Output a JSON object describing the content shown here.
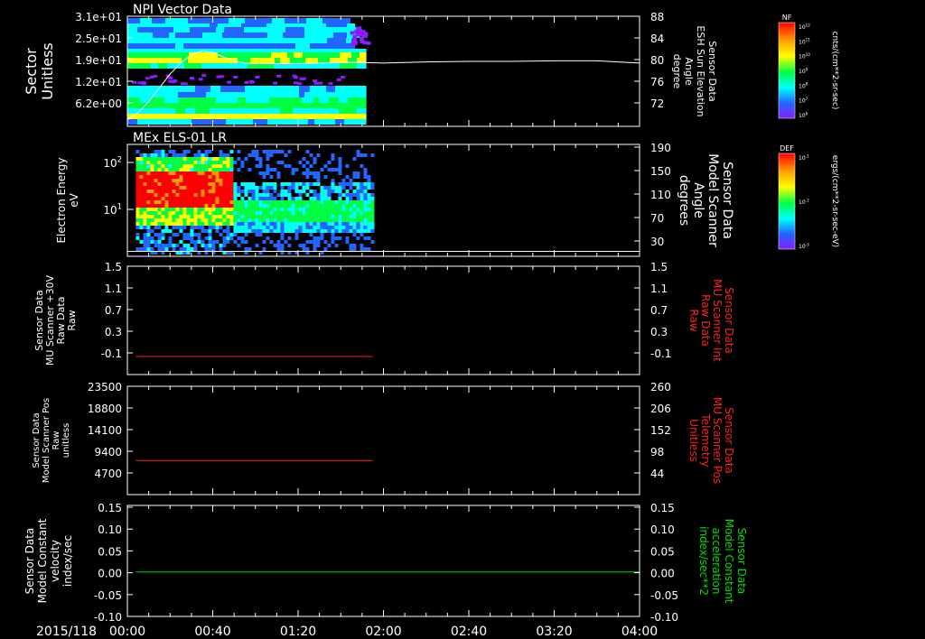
{
  "date_label": "2015/118",
  "time_axis": {
    "range_minutes": [
      0,
      240
    ],
    "tick_labels": [
      "00:00",
      "00:40",
      "01:20",
      "02:00",
      "02:40",
      "03:20",
      "04:00"
    ]
  },
  "colors": {
    "axis": "#ffffff",
    "red_series": "#ff2020",
    "green_series": "#00e000",
    "right_label_red": "#ff2020",
    "right_label_green": "#00e000"
  },
  "chart_data": [
    {
      "id": "panel1",
      "type": "heatmap",
      "title": "NPI Vector Data",
      "ylabel": [
        "Sector",
        "Unitless"
      ],
      "y_ticks": [
        "3.1e+01",
        "2.5e+01",
        "1.9e+01",
        "1.2e+01",
        "6.2e+00"
      ],
      "y2_ticks": [
        "88",
        "84",
        "80",
        "76",
        "72"
      ],
      "y2_range": [
        68,
        88
      ],
      "y2label": [
        "Sensor Data",
        "ESH Sun Elevation",
        "Angle",
        "degree"
      ],
      "colorbar": {
        "name": "NF",
        "units": "cnts/(cm**2-sr-sec)",
        "ticks": [
          "10^12",
          "10^11",
          "10^10",
          "10^9",
          "10^8",
          "10^7",
          "10^6"
        ]
      },
      "data_extent_minutes": [
        0,
        112
      ],
      "line_series": {
        "name": "ESH Sun Elevation Angle",
        "x": [
          0,
          5,
          10,
          15,
          20,
          25,
          30,
          35,
          40,
          45,
          50,
          55,
          60,
          70,
          80,
          90,
          100,
          110,
          120,
          140,
          160,
          180,
          200,
          220,
          235,
          240
        ],
        "y": [
          69.2,
          70.5,
          72.5,
          75.0,
          77.5,
          79.5,
          81.0,
          81.7,
          81.4,
          80.6,
          79.9,
          79.5,
          79.4,
          79.4,
          79.4,
          79.5,
          79.6,
          79.6,
          79.5,
          79.7,
          79.8,
          79.8,
          79.9,
          79.9,
          79.6,
          79.5
        ]
      }
    },
    {
      "id": "panel2",
      "type": "heatmap",
      "title": "MEx ELS-01 LR",
      "ylabel": [
        "Electron Energy",
        "eV"
      ],
      "y_ticks": [
        "10^2",
        "10^1"
      ],
      "y2_ticks": [
        "190",
        "150",
        "110",
        "70",
        "30"
      ],
      "y2_range": [
        10,
        190
      ],
      "y2label": [
        "Sensor Data",
        "Model Scanner",
        "Angle",
        "degrees"
      ],
      "colorbar": {
        "name": "DEF",
        "units": "ergs/(cm**2-sr-sec-eV)",
        "ticks": [
          "10^-1",
          "10^-2",
          "10^-3"
        ]
      },
      "data_extent_minutes": [
        4,
        115
      ],
      "line_series": {
        "name": "Model Scanner Angle",
        "x": [
          0,
          240
        ],
        "y": [
          18,
          18
        ]
      }
    },
    {
      "id": "panel3",
      "type": "line",
      "ylabel": [
        "Sensor Data",
        "MU Scanner +30V",
        "Raw Data",
        "Raw"
      ],
      "y_ticks": [
        "1.5",
        "1.1",
        "0.7",
        "0.3",
        "-0.1"
      ],
      "y_range": [
        -0.3,
        1.5
      ],
      "y2_ticks": [
        "1.5",
        "1.1",
        "0.7",
        "0.3",
        "-0.1"
      ],
      "y2label": [
        "Sensor Data",
        "MU Scanner Int",
        "Raw Data",
        "Raw"
      ],
      "series": [
        {
          "name": "MU Scanner Int Raw Data",
          "color": "red",
          "x": [
            4,
            115
          ],
          "y": [
            0.0,
            0.0
          ]
        }
      ]
    },
    {
      "id": "panel4",
      "type": "line",
      "ylabel": [
        "Sensor Data",
        "Model Scanner Pos",
        "Raw",
        "unitless"
      ],
      "y_ticks": [
        "23500",
        "18800",
        "14100",
        "9400",
        "4700"
      ],
      "y_range": [
        0,
        23500
      ],
      "y2_ticks": [
        "260",
        "206",
        "152",
        "98",
        "44"
      ],
      "y2label": [
        "Sensor Data",
        "MU Scanner Pos",
        "Telemetry",
        "Unitless"
      ],
      "series": [
        {
          "name": "MU Scanner Pos Telemetry",
          "color": "red",
          "x": [
            4,
            115
          ],
          "y": [
            7400,
            7400
          ]
        }
      ]
    },
    {
      "id": "panel5",
      "type": "line",
      "ylabel": [
        "Sensor Data",
        "Model Constant",
        "velocity",
        "index/sec"
      ],
      "y_ticks": [
        "0.15",
        "0.10",
        "0.05",
        "0.00",
        "-0.05",
        "-0.10"
      ],
      "y_range": [
        -0.1,
        0.15
      ],
      "y2_ticks": [
        "0.15",
        "0.10",
        "0.05",
        "0.00",
        "-0.05",
        "-0.10"
      ],
      "y2label": [
        "Sensor Data",
        "Model Constant",
        "acceleration",
        "index/sec**2"
      ],
      "series": [
        {
          "name": "Model Constant acceleration",
          "color": "green",
          "x": [
            4,
            240
          ],
          "y": [
            0.0,
            0.0
          ]
        }
      ]
    }
  ]
}
